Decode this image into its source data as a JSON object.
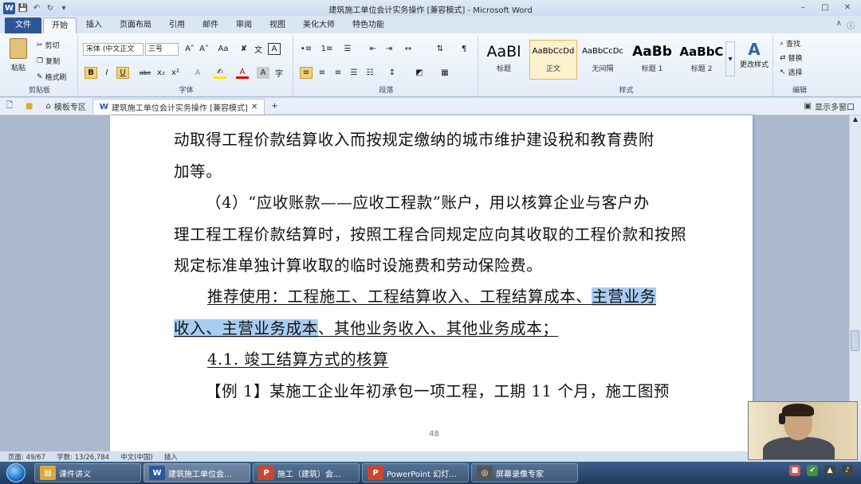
{
  "title_bar": {
    "title": "建筑施工单位会计实务操作 [兼容模式] - Microsoft Word"
  },
  "ribbon_tabs": [
    "文件",
    "开始",
    "插入",
    "页面布局",
    "引用",
    "邮件",
    "审阅",
    "视图",
    "美化大师",
    "特色功能"
  ],
  "clipboard": {
    "paste": "粘贴",
    "cut": "剪切",
    "copy": "复制",
    "format_painter": "格式刷",
    "group": "剪贴板"
  },
  "font": {
    "name": "宋体 (中文正文",
    "size": "三号",
    "group": "字体"
  },
  "paragraph": {
    "group": "段落"
  },
  "styles": {
    "items": [
      {
        "sample": "AaBl",
        "name": "标题"
      },
      {
        "sample": "AaBbCcDd",
        "name": "正文"
      },
      {
        "sample": "AaBbCcDc",
        "name": "无间隔"
      },
      {
        "sample": "AaBb",
        "name": "标题 1"
      },
      {
        "sample": "AaBbC",
        "name": "标题 2"
      }
    ],
    "change_styles": "更改样式",
    "group": "样式"
  },
  "editing": {
    "find": "查找",
    "replace": "替换",
    "select": "选择",
    "group": "编辑"
  },
  "doc_tabs": {
    "template": "模板专区",
    "doc": "建筑施工单位会计实务操作 [兼容模式]",
    "multi_window": "显示多窗口"
  },
  "document": {
    "line1": "动取得工程价款结算收入而按规定缴纳的城市维护建设税和教育费附",
    "line2": "加等。",
    "line3": "（4）“应收账款——应收工程款”账户，用以核算企业与客户办",
    "line4": "理工程工程价款结算时，按照工程合同规定应向其收取的工程价款和按照",
    "line5": "规定标准单独计算收取的临时设施费和劳动保险费。",
    "line6a": "推荐使用：工程施工、工程结算收入、工程结算成本、",
    "line6b": "主营业务",
    "line7a": "收入、主营业务成本",
    "line7b": "、其他业务收入、其他业务成本；",
    "line8": "4.1. 竣工结算方式的核算",
    "line9": "【例 1】某施工企业年初承包一项工程，工期 11 个月，施工图预",
    "page_number": "48"
  },
  "status_bar": {
    "page": "页面: 49/67",
    "words": "字数: 13/26,784",
    "lang": "中文(中国)",
    "mode": "插入"
  },
  "taskbar": [
    {
      "label": "课件讲义",
      "icon": "folder-icon",
      "color": "#d9a93a"
    },
    {
      "label": "建筑施工单位会...",
      "icon": "word-icon",
      "color": "#2b579a"
    },
    {
      "label": "施工（建筑）会...",
      "icon": "powerpoint-icon",
      "color": "#c8482c"
    },
    {
      "label": "PowerPoint 幻灯...",
      "icon": "powerpoint-icon",
      "color": "#c8482c"
    },
    {
      "label": "屏幕录像专家",
      "icon": "recorder-icon",
      "color": "#555"
    }
  ]
}
